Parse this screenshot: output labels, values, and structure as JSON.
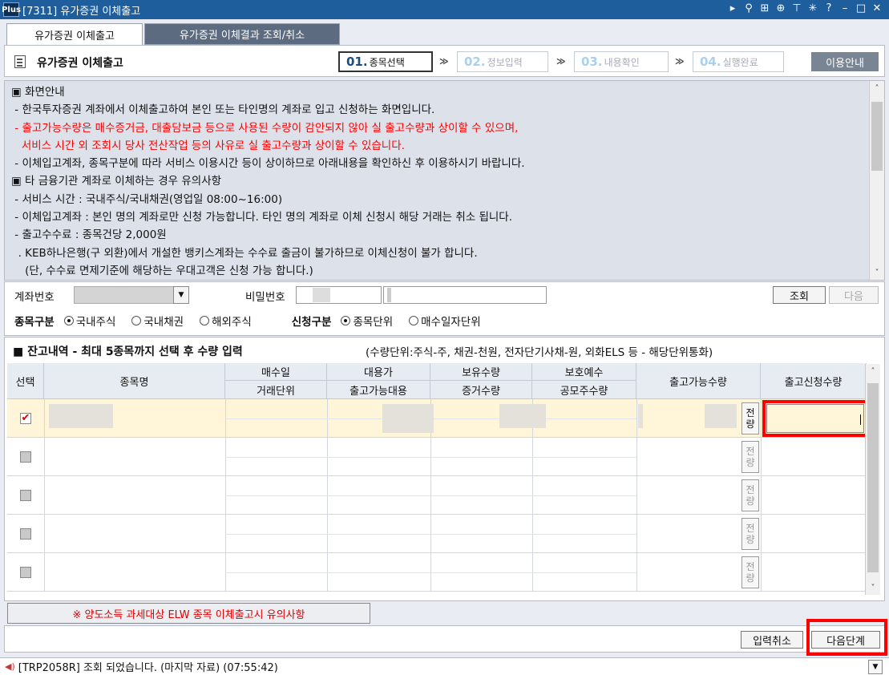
{
  "window": {
    "logo": "Plus",
    "title": "[7311] 유가증권 이체출고",
    "icons": [
      "arrow-right-icon",
      "search-icon",
      "layout-icon",
      "zoom-icon",
      "pin-icon",
      "settings-icon",
      "help-icon",
      "minimize-icon",
      "maximize-icon",
      "close-icon"
    ],
    "icon_glyphs": [
      "▸",
      "⚲",
      "⊞",
      "⊕",
      "⊤",
      "✳",
      "?",
      "–",
      "□",
      "✕"
    ]
  },
  "tabs": [
    {
      "label": "유가증권 이체출고",
      "active": true
    },
    {
      "label": "유가증권 이체결과 조회/취소",
      "active": false
    }
  ],
  "header": {
    "title": "유가증권 이체출고",
    "steps": [
      {
        "num": "01.",
        "label": "종목선택",
        "active": true
      },
      {
        "num": "02.",
        "label": "정보입력",
        "active": false
      },
      {
        "num": "03.",
        "label": "내용확인",
        "active": false
      },
      {
        "num": "04.",
        "label": "실행완료",
        "active": false
      }
    ],
    "arrow": "≫",
    "guide_label": "이용안내"
  },
  "notice": {
    "lines": [
      {
        "text": "▣ 화면안내",
        "color": "black"
      },
      {
        "text": " - 한국투자증권 계좌에서 이체출고하여 본인 또는 타인명의 계좌로 입고 신청하는 화면입니다.",
        "color": "black"
      },
      {
        "text": " - 출고가능수량은 매수증거금, 대출담보금 등으로 사용된 수량이 감안되지 않아 실 출고수량과 상이할 수 있으며,",
        "color": "red"
      },
      {
        "text": "   서비스 시간 외 조회시 당사 전산작업 등의 사유로 실 출고수량과 상이할 수 있습니다.",
        "color": "red"
      },
      {
        "text": " - 이체입고계좌, 종목구분에 따라 서비스 이용시간 등이 상이하므로 아래내용을 확인하신 후 이용하시기 바랍니다.",
        "color": "black"
      },
      {
        "text": "▣ 타 금융기관 계좌로 이체하는 경우 유의사항",
        "color": "black"
      },
      {
        "text": " - 서비스 시간 : 국내주식/국내채권(영업일 08:00~16:00)",
        "color": "black"
      },
      {
        "text": " - 이체입고계좌 : 본인 명의 계좌로만 신청 가능합니다. 타인 명의 계좌로 이체 신청시 해당 거래는 취소 됩니다.",
        "color": "black"
      },
      {
        "text": " - 출고수수료 : 종목건당 2,000원",
        "color": "black"
      },
      {
        "text": "  . KEB하나은행(구 외환)에서 개설한 뱅키스계좌는 수수료 출금이 불가하므로 이체신청이 불가 합니다.",
        "color": "black"
      },
      {
        "text": "    (단, 수수료 면제기준에 해당하는 우대고객은 신청 가능 합니다.)",
        "color": "black"
      }
    ],
    "scroll_up": "˄",
    "scroll_down": "˅"
  },
  "form": {
    "account_label": "계좌번호",
    "account_value": "",
    "dropdown_glyph": "▼",
    "password_label": "비밀번호",
    "query_label": "조회",
    "next_label": "다음",
    "item_type_label": "종목구분",
    "item_type_options": [
      {
        "label": "국내주식",
        "selected": true
      },
      {
        "label": "국내채권",
        "selected": false
      },
      {
        "label": "해외주식",
        "selected": false
      }
    ],
    "request_type_label": "신청구분",
    "request_type_options": [
      {
        "label": "종목단위",
        "selected": true
      },
      {
        "label": "매수일자단위",
        "selected": false
      }
    ]
  },
  "holdings": {
    "title": "■ 잔고내역 - 최대 5종목까지 선택 후 수량 입력",
    "unit_note": "(수량단위:주식-주, 채권-천원, 전자단기사채-원, 외화ELS 등 - 해당단위통화)",
    "headers": {
      "select": "선택",
      "name": "종목명",
      "buy_date": "매수일",
      "trade_unit": "거래단위",
      "loan_price": "대용가",
      "out_loan": "출고가능대용",
      "held_qty": "보유수량",
      "margin_qty": "증거수량",
      "protect_dep": "보호예수",
      "offer_qty": "공모주수량",
      "avail_qty": "출고가능수량",
      "request_qty": "출고신청수량"
    },
    "full_label": "전량",
    "rows": [
      {
        "checked": true,
        "request_qty": ""
      },
      {
        "checked": false,
        "request_qty": ""
      },
      {
        "checked": false,
        "request_qty": ""
      },
      {
        "checked": false,
        "request_qty": ""
      },
      {
        "checked": false,
        "request_qty": ""
      }
    ]
  },
  "bottom": {
    "elw_notice": "※ 양도소득 과세대상 ELW 종목 이체출고시 유의사항",
    "cancel_label": "입력취소",
    "next_step_label": "다음단계"
  },
  "status": {
    "icon": "speaker-icon",
    "message": "[TRP2058R] 조회 되었습니다. (마지막 자료) (07:55:42)",
    "dropdown_glyph": "▼"
  },
  "colors": {
    "titlebar": "#1f5e9c",
    "tab_inactive": "#5c6b80",
    "highlight": "#ff0000",
    "warning_text": "#ff0000",
    "selected_row": "#fff5d9"
  }
}
